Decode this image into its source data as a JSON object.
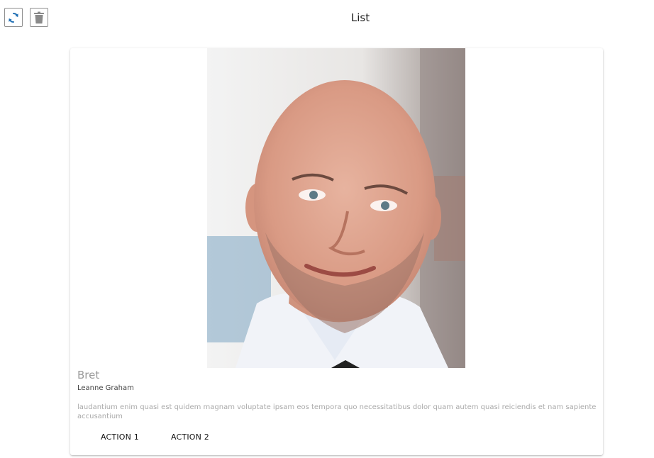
{
  "header": {
    "title": "List",
    "refresh_icon": "refresh-icon",
    "delete_icon": "trash-icon"
  },
  "card": {
    "title": "Bret",
    "subtitle": "Leanne Graham",
    "body": "laudantium enim quasi est quidem magnam voluptate ipsam eos tempora quo necessitatibus dolor quam autem quasi reiciendis et nam sapiente accusantium",
    "actions": [
      "ACTION 1",
      "ACTION 2"
    ],
    "image": "photo of a smiling bald man in a white shirt"
  },
  "colors": {
    "refresh_icon": "#1f6fb4",
    "delete_icon": "#8a8a8a",
    "title_gray": "#9a9a9a",
    "body_gray": "#a9a9a9"
  }
}
